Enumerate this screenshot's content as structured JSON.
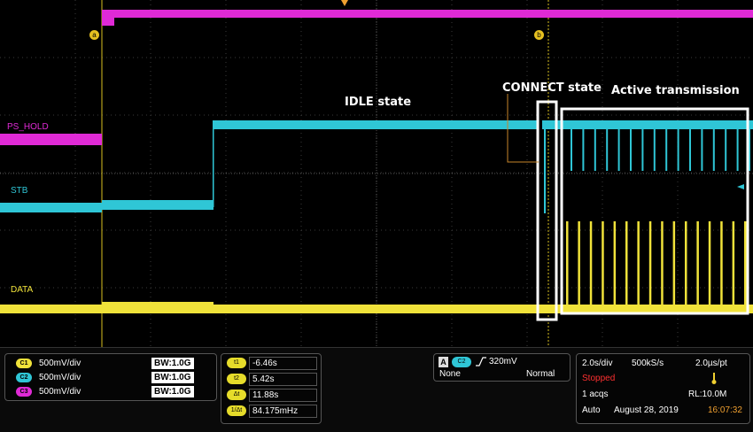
{
  "cursors_markers": {
    "a": "a",
    "b": "b"
  },
  "annotations": {
    "idle": "IDLE state",
    "connect": "CONNECT state",
    "active": "Active transmission"
  },
  "channel_labels": {
    "ps_hold": "PS_HOLD",
    "stb": "STB",
    "data": "DATA"
  },
  "colors": {
    "c1": "#f0e23a",
    "c2": "#2fc6d6",
    "c3": "#e02ad6",
    "stopped": "#ff3030",
    "time": "#f0a030"
  },
  "channels": [
    {
      "badge": "C1",
      "scale": "500mV/div",
      "bw": "BW:1.0G"
    },
    {
      "badge": "C2",
      "scale": "500mV/div",
      "bw": "BW:1.0G"
    },
    {
      "badge": "C3",
      "scale": "500mV/div",
      "bw": "BW:1.0G"
    }
  ],
  "cursors": [
    {
      "label": "t1",
      "value": "-6.46s"
    },
    {
      "label": "t2",
      "value": "5.42s"
    },
    {
      "label": "Δt",
      "value": "11.88s"
    },
    {
      "label": "1/Δt",
      "value": "84.175mHz"
    }
  ],
  "trigger": {
    "mode_letter": "A",
    "source": "C2",
    "level": "320mV",
    "coupling": "None",
    "type": "Normal"
  },
  "acquisition": {
    "timebase": "2.0s/div",
    "sample_rate": "500kS/s",
    "resolution": "2.0µs/pt",
    "status": "Stopped",
    "acqs": "1 acqs",
    "record_length": "RL:10.0M",
    "mode": "Auto",
    "date": "August 28, 2019",
    "time": "16:07:32"
  }
}
